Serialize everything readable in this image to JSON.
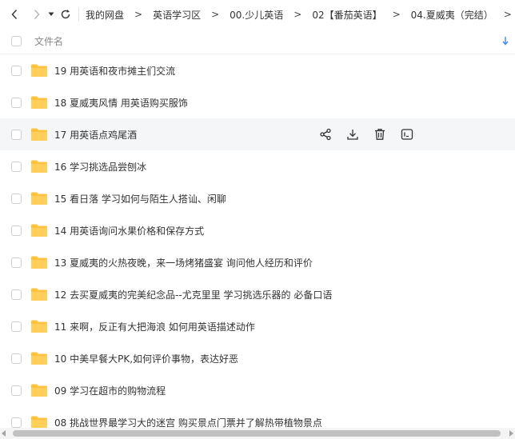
{
  "breadcrumb": [
    "我的网盘",
    "英语学习区",
    "00.少儿英语",
    "02【番茄英语】",
    "04.夏威夷（完结）"
  ],
  "crumb_sep": ">",
  "header": {
    "column_name": "文件名"
  },
  "files": [
    "19 用英语和夜市摊主们交流",
    "18 夏威夷风情 用英语购买服饰",
    "17 用英语点鸡尾酒",
    "16 学习挑选品尝刨冰",
    "15 看日落 学习如何与陌生人搭讪、闲聊",
    "14 用英语询问水果价格和保存方式",
    "13 夏威夷的火热夜晚，来一场烤猪盛宴  询问他人经历和评价",
    "12 去买夏威夷的完美纪念品--尤克里里 学习挑选乐器的 必备口语",
    "11 来啊，反正有大把海浪 如何用英语描述动作",
    "10 中美早餐大PK,如何评价事物，表达好恶",
    "09 学习在超市的购物流程",
    "08 挑战世界最学习大的迷宫 购买景点门票并了解热带植物景点"
  ],
  "hover_row": 2,
  "colors": {
    "folder": "#ffc23f",
    "accent": "#3b8cf5"
  }
}
